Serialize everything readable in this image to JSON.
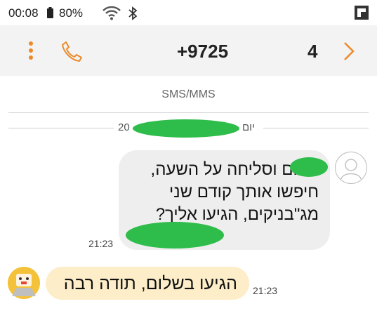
{
  "status_bar": {
    "time": "00:08",
    "battery_percent": "80%",
    "icons": [
      "battery-icon",
      "wifi-icon",
      "bluetooth-icon",
      "screenshot-icon"
    ]
  },
  "header": {
    "number_start": "+9725",
    "number_end": "4",
    "accent_color": "#ec8a2b",
    "icons": [
      "more-vert-icon",
      "phone-icon",
      "chevron-right-icon"
    ]
  },
  "thread": {
    "channel_label": "SMS/MMS",
    "date_prefix": "20",
    "date_suffix": "יום",
    "messages": [
      {
        "direction": "incoming",
        "text": "שלום וסליחה על השעה, חיפשו אותך קודם שני מג\"בניקים, הגיעו אליך?",
        "time": "21:23",
        "bubble_color": "#eeeeee"
      },
      {
        "direction": "outgoing",
        "text": "הגיעו בשלום, תודה רבה",
        "time": "21:23",
        "bubble_color": "#fdeec9"
      }
    ]
  },
  "redaction_color": "#2ebd4a"
}
